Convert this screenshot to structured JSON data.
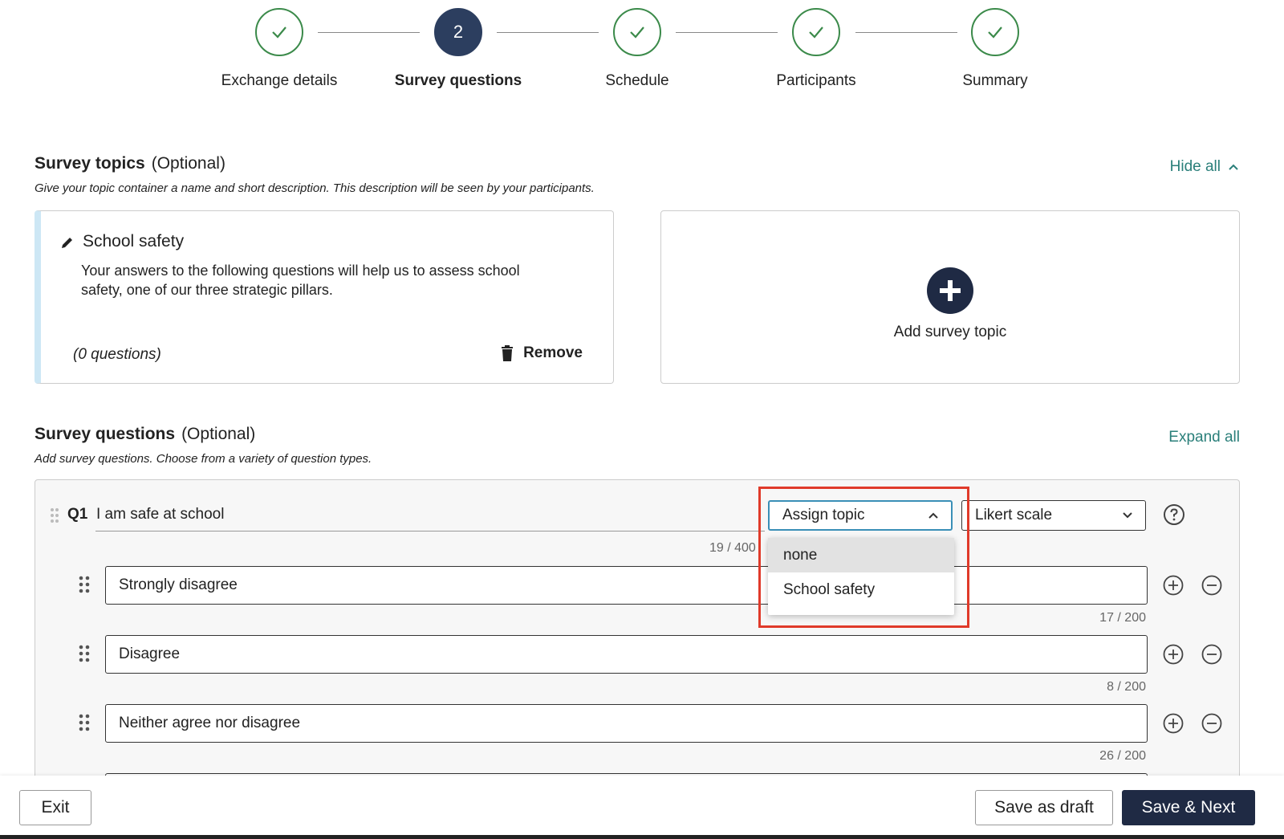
{
  "stepper": {
    "steps": [
      {
        "label": "Exchange details",
        "state": "done"
      },
      {
        "label": "Survey questions",
        "state": "active",
        "number": "2"
      },
      {
        "label": "Schedule",
        "state": "done"
      },
      {
        "label": "Participants",
        "state": "done"
      },
      {
        "label": "Summary",
        "state": "done"
      }
    ]
  },
  "topics": {
    "title": "Survey topics",
    "optional": "(Optional)",
    "description": "Give your topic container a name and short description. This description will be seen by your participants.",
    "hide_all": "Hide all",
    "card": {
      "name": "School safety",
      "description": "Your answers to the following questions will help us to assess school safety, one of our three strategic pillars.",
      "count": "(0 questions)",
      "remove": "Remove"
    },
    "add_label": "Add survey topic"
  },
  "questions": {
    "title": "Survey questions",
    "optional": "(Optional)",
    "description": "Add survey questions. Choose from a variety of question types.",
    "expand_all": "Expand all",
    "q1": {
      "number": "Q1",
      "text": "I am safe at school",
      "count": "19 / 400",
      "assign_topic": "Assign topic",
      "type": "Likert scale",
      "options": [
        {
          "text": "Strongly disagree",
          "count": "17 / 200"
        },
        {
          "text": "Disagree",
          "count": "8 / 200"
        },
        {
          "text": "Neither agree nor disagree",
          "count": "26 / 200"
        }
      ]
    },
    "dropdown": {
      "items": [
        "none",
        "School safety"
      ]
    }
  },
  "footer": {
    "exit": "Exit",
    "save_draft": "Save as draft",
    "save_next": "Save & Next"
  },
  "colors": {
    "accent": "#2a7f7a",
    "primary": "#1f2a44",
    "check": "#3b8a4a",
    "highlight": "#e03a2a"
  }
}
